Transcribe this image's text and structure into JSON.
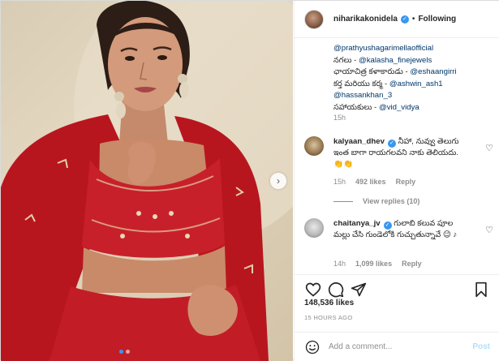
{
  "post": {
    "username": "niharikakonidela",
    "separator": "•",
    "follow_label": "Following",
    "image_alt": "Woman in red embroidered outfit"
  },
  "caption": {
    "lines": [
      {
        "text": "@prathyushagarimellaofficial",
        "mention": true
      },
      {
        "prefix": "నగలు - ",
        "text": "@kalasha_finejewels"
      },
      {
        "prefix": "ఛాయాచిత్ర కళాకారుడు - ",
        "text": "@eshaangirri"
      },
      {
        "prefix": "కర్త మరియు కర్మ - ",
        "text": "@ashwin_ash1"
      },
      {
        "text": "@hassankhan_3",
        "mention": true
      },
      {
        "prefix": "సహాయకులు - ",
        "text": "@vid_vidya"
      }
    ],
    "time": "15h"
  },
  "comments": [
    {
      "username": "kalyaan_dhev",
      "text": "నీహా, నువ్వు తెలుగు ఇంత బాగా రాయగలవని నాకు తెలియదు. 👏👏",
      "time": "15h",
      "likes": "492 likes",
      "reply_label": "Reply",
      "view_replies": "View replies (10)"
    },
    {
      "username": "chaitanya_jv",
      "text": "గులాబి కలువ పూల మల్లు చేసి గుండెలోకి గుచ్చుతున్నావే 😉 ♪",
      "time": "14h",
      "likes": "1,099 likes",
      "reply_label": "Reply"
    }
  ],
  "footer": {
    "likes": "148,536 likes",
    "ago": "15 HOURS AGO",
    "comment_placeholder": "Add a comment...",
    "post_label": "Post"
  },
  "icons": {
    "like": "heart-icon",
    "comment": "comment-bubble-icon",
    "share": "paper-plane-icon",
    "save": "bookmark-icon",
    "emoji": "smiley-icon",
    "verified": "verified-badge-icon",
    "next": "chevron-right-icon"
  },
  "colors": {
    "accent": "#3897f0",
    "mention": "#00376b",
    "muted": "#8e8e8e",
    "dress": "#c8202a",
    "post_disabled": "#b2dffc"
  }
}
